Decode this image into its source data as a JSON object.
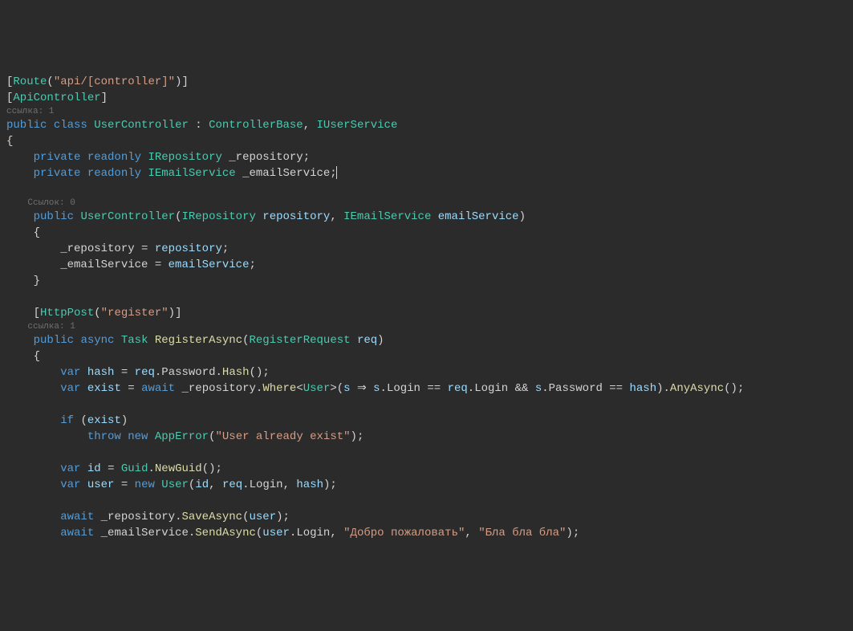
{
  "codelens": {
    "class": "ссылка: 1",
    "ctor": "Ссылок: 0",
    "register": "ссылка: 1"
  },
  "tok": {
    "lbracket": "[",
    "rbracket": "]",
    "lparen": "(",
    "rparen": ")",
    "lbrace": "{",
    "rbrace": "}",
    "semi": ";",
    "comma": ",",
    "dot": ".",
    "colon": ":",
    "lt": "<",
    "gt": ">",
    "assign": "=",
    "eq": "==",
    "and": "&&",
    "arrow": "⇒",
    "public": "public",
    "private": "private",
    "readonly": "readonly",
    "class": "class",
    "async": "async",
    "var": "var",
    "await": "await",
    "if": "if",
    "throw": "throw",
    "new": "new",
    "Route": "Route",
    "ApiController": "ApiController",
    "HttpPost": "HttpPost",
    "UserController": "UserController",
    "ControllerBase": "ControllerBase",
    "IUserService": "IUserService",
    "IRepository": "IRepository",
    "IEmailService": "IEmailService",
    "Task": "Task",
    "RegisterRequest": "RegisterRequest",
    "User": "User",
    "Guid": "Guid",
    "AppError": "AppError",
    "repoField": "_repository",
    "emailField": "_emailService",
    "repoParam": "repository",
    "emailParam": "emailService",
    "RegisterAsync": "RegisterAsync",
    "req": "req",
    "hash": "hash",
    "exist": "exist",
    "id": "id",
    "user": "user",
    "s": "s",
    "Password": "Password",
    "Login": "Login",
    "Hash": "Hash",
    "Where": "Where",
    "AnyAsync": "AnyAsync",
    "NewGuid": "NewGuid",
    "SaveAsync": "SaveAsync",
    "SendAsync": "SendAsync",
    "strRoute": "\"api/[controller]\"",
    "strRegister": "\"register\"",
    "strUserExist": "\"User already exist\"",
    "strWelcome": "\"Добро пожаловать\"",
    "strBla": "\"Бла бла бла\""
  },
  "indent": {
    "i1": "    ",
    "i2": "        ",
    "i3": "            "
  }
}
